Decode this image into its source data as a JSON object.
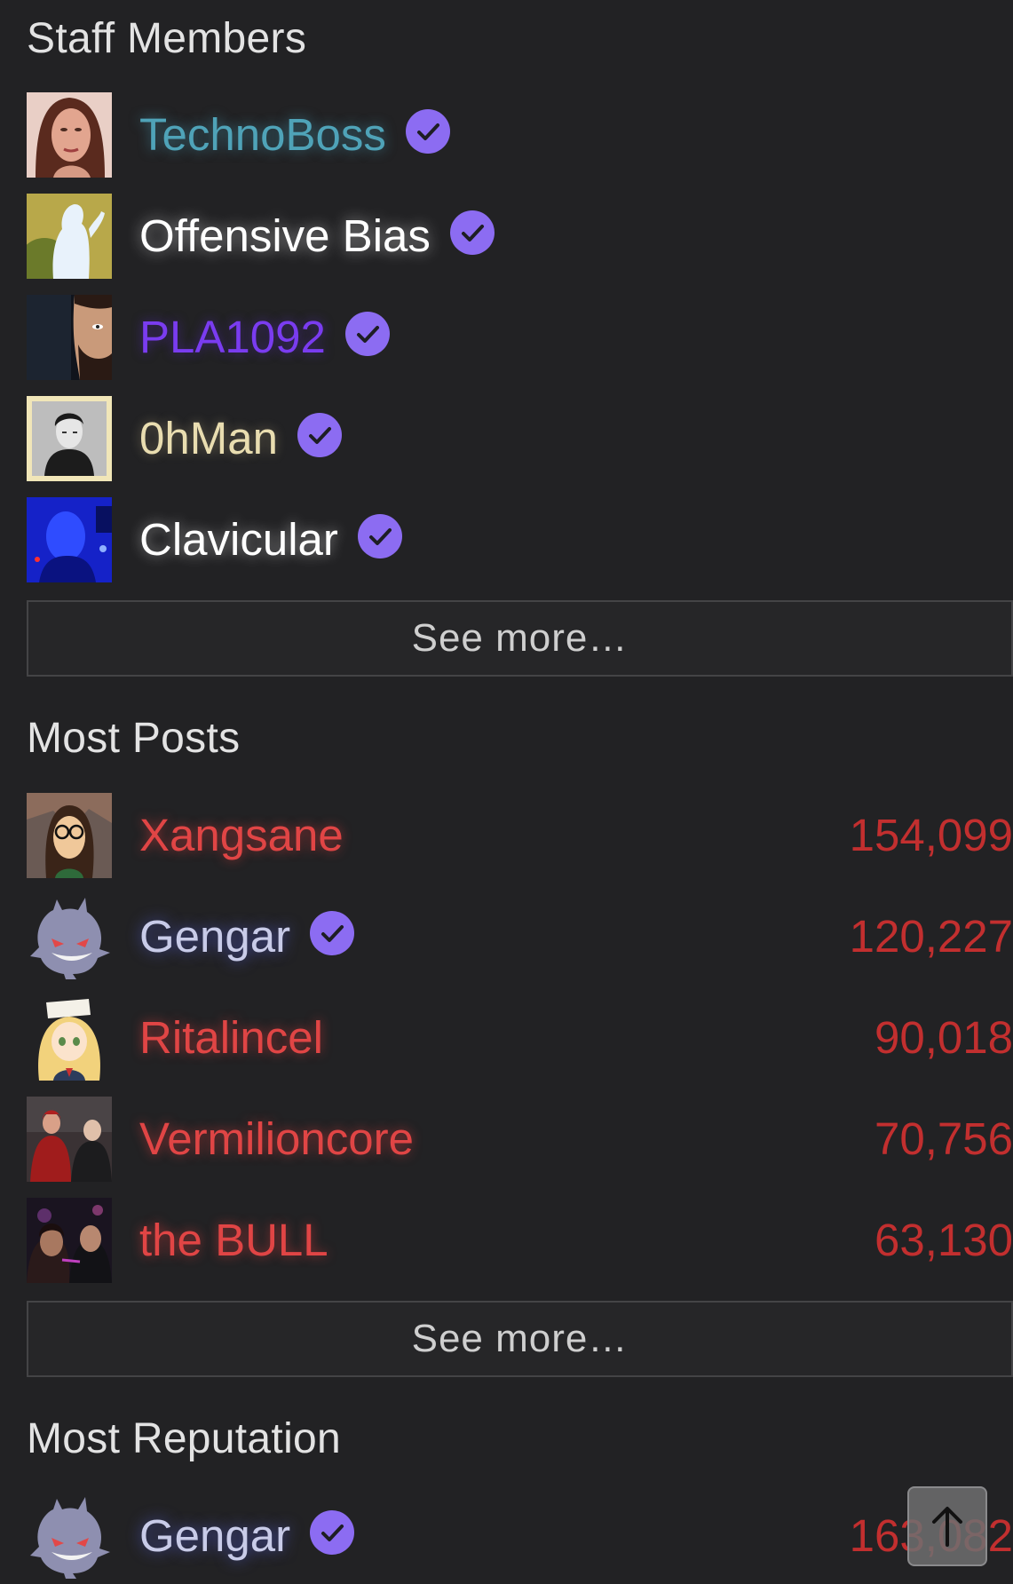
{
  "staff": {
    "title": "Staff Members",
    "see_more": "See more…",
    "members": [
      {
        "name": "TechnoBoss",
        "verified": true,
        "avatar": "portrait-woman-avatar"
      },
      {
        "name": "Offensive Bias",
        "verified": true,
        "avatar": "silhouette-avatar"
      },
      {
        "name": "PLA1092",
        "verified": true,
        "avatar": "cartoon-man-avatar"
      },
      {
        "name": "0hMan",
        "verified": true,
        "avatar": "bw-photo-avatar"
      },
      {
        "name": "Clavicular",
        "verified": true,
        "avatar": "blue-face-avatar"
      }
    ]
  },
  "most_posts": {
    "title": "Most Posts",
    "see_more": "See more…",
    "members": [
      {
        "name": "Xangsane",
        "count": "154,099",
        "verified": false,
        "avatar": "glasses-cartoon-avatar"
      },
      {
        "name": "Gengar",
        "count": "120,227",
        "verified": true,
        "avatar": "gengar-avatar"
      },
      {
        "name": "Ritalincel",
        "count": "90,018",
        "verified": false,
        "avatar": "anime-girl-avatar"
      },
      {
        "name": "Vermilioncore",
        "count": "70,756",
        "verified": false,
        "avatar": "two-men-avatar"
      },
      {
        "name": "the BULL",
        "count": "63,130",
        "verified": false,
        "avatar": "couple-photo-avatar"
      }
    ]
  },
  "most_reputation": {
    "title": "Most Reputation",
    "members": [
      {
        "name": "Gengar",
        "count": "163,082",
        "verified": true,
        "avatar": "gengar-avatar"
      }
    ]
  },
  "icons": {
    "verified": "check-badge-icon",
    "scroll_top": "arrow-up-icon"
  },
  "colors": {
    "background": "#222224",
    "verified_badge": "#8c6cf2",
    "count": "#c22f2f",
    "red_name": "#e04545",
    "technoboss": "#4fa3b8",
    "pla1092": "#7a3cf0",
    "ohman": "#e9ddb0"
  }
}
